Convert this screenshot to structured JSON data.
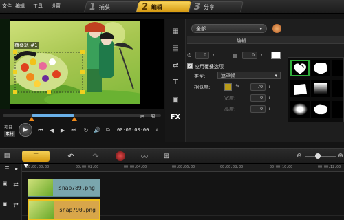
{
  "menu": {
    "file": "文件",
    "edit": "编辑",
    "tools": "工具",
    "settings": "设置"
  },
  "steps": [
    {
      "num": "1",
      "label": "捕获"
    },
    {
      "num": "2",
      "label": "编辑"
    },
    {
      "num": "3",
      "label": "分享"
    }
  ],
  "preview": {
    "overlay_label": "覆叠轨 #1"
  },
  "transport": {
    "mode_project": "项目",
    "mode_clip": "素材",
    "timecode": "00:00:00:00"
  },
  "options": {
    "category": "全部",
    "panel_tab_edit": "编辑",
    "value1": "0",
    "value2": "0",
    "apply_overlay": "应用覆叠选项",
    "type_label": "类型:",
    "type_value": "遮罩帧",
    "similarity_label": "相似度:",
    "similarity_value": "70",
    "width_label": "宽度:",
    "width_value": "0",
    "height_label": "高度:",
    "height_value": "0"
  },
  "timeline": {
    "ticks": [
      "00:00:00:00",
      "00:00:02:00",
      "00:00:04:00",
      "00:00:06:00",
      "00:00:08:00",
      "00:00:10:00",
      "00:00:12:00"
    ],
    "clips": [
      {
        "name": "snap789.png"
      },
      {
        "name": "snap790.png"
      }
    ]
  },
  "icons": [
    "capture-icon",
    "media-icon",
    "transition-icon",
    "title-icon",
    "graphic-icon",
    "filter-icon",
    "play-icon",
    "undo-icon",
    "redo-icon"
  ]
}
